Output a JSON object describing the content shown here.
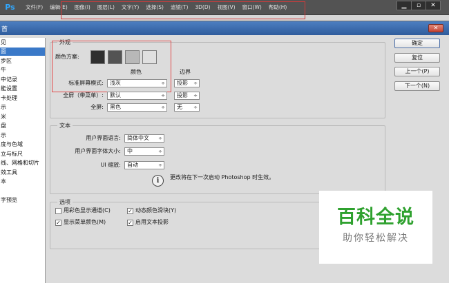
{
  "app": {
    "logo": "Ps",
    "menu": [
      "文件(F)",
      "编辑(E)",
      "图像(I)",
      "图层(L)",
      "文字(Y)",
      "选择(S)",
      "滤镜(T)",
      "3D(D)",
      "视图(V)",
      "窗口(W)",
      "帮助(H)"
    ],
    "window_controls": {
      "minimize": "▁",
      "maximize": "▫",
      "close": "✕"
    }
  },
  "dialog": {
    "title": "首",
    "close_glyph": "✕",
    "sidebar_items": [
      {
        "label": "见",
        "selected": false
      },
      {
        "label": "面",
        "selected": true
      },
      {
        "label": "步区",
        "selected": false
      },
      {
        "label": "牛",
        "selected": false
      },
      {
        "label": "中记录",
        "selected": false
      },
      {
        "label": "能设置",
        "selected": false
      },
      {
        "label": "卡处理",
        "selected": false
      },
      {
        "label": "示",
        "selected": false
      },
      {
        "label": "米",
        "selected": false
      },
      {
        "label": "盘",
        "selected": false
      },
      {
        "label": "示",
        "selected": false
      },
      {
        "label": "度与色域",
        "selected": false
      },
      {
        "label": "立与标尺",
        "selected": false
      },
      {
        "label": "线、网格和切片",
        "selected": false
      },
      {
        "label": "效工具",
        "selected": false
      },
      {
        "label": "本",
        "selected": false
      },
      {
        "label": "",
        "selected": false
      },
      {
        "label": "字预览",
        "selected": false
      }
    ],
    "appearance": {
      "title": "外观",
      "color_scheme_label": "颜色方案:",
      "swatches": [
        "#2f2f2f",
        "#535353",
        "#b8b8b8",
        "#e0e0e0"
      ],
      "col_color": "颜色",
      "col_border": "边界",
      "rows": [
        {
          "label": "标准屏幕模式:",
          "color": "浅灰",
          "border": "投影"
        },
        {
          "label": "全屏（带菜单）:",
          "color": "默认",
          "border": "投影"
        },
        {
          "label": "全屏:",
          "color": "黑色",
          "border": "无"
        }
      ]
    },
    "text": {
      "title": "文本",
      "ui_language_label": "用户界面语言:",
      "ui_language_value": "简体中文",
      "ui_font_size_label": "用户界面字体大小:",
      "ui_font_size_value": "中",
      "ui_scaling_label": "UI 缩放:",
      "ui_scaling_value": "自动",
      "info_glyph": "i",
      "info_text": "更改将在下一次启动 Photoshop 时生效。"
    },
    "options": {
      "title": "选项",
      "items": [
        {
          "label": "用彩色显示通道(C)",
          "checked": false
        },
        {
          "label": "动态颜色滑块(Y)",
          "checked": true
        },
        {
          "label": "显示菜单颜色(M)",
          "checked": true
        },
        {
          "label": "启用文本投影",
          "checked": true
        }
      ],
      "check_glyph": "✓"
    },
    "buttons": {
      "ok": "确定",
      "reset": "复位",
      "prev": "上一个(P)",
      "next": "下一个(N)"
    },
    "caret_glyph": "÷"
  },
  "watermark": {
    "title": "百科全说",
    "subtitle": "助你轻松解决"
  },
  "colors": {
    "accent_green": "#2fa12f",
    "selection_blue": "#3a79c8",
    "highlight_red": "#e24a4a"
  }
}
